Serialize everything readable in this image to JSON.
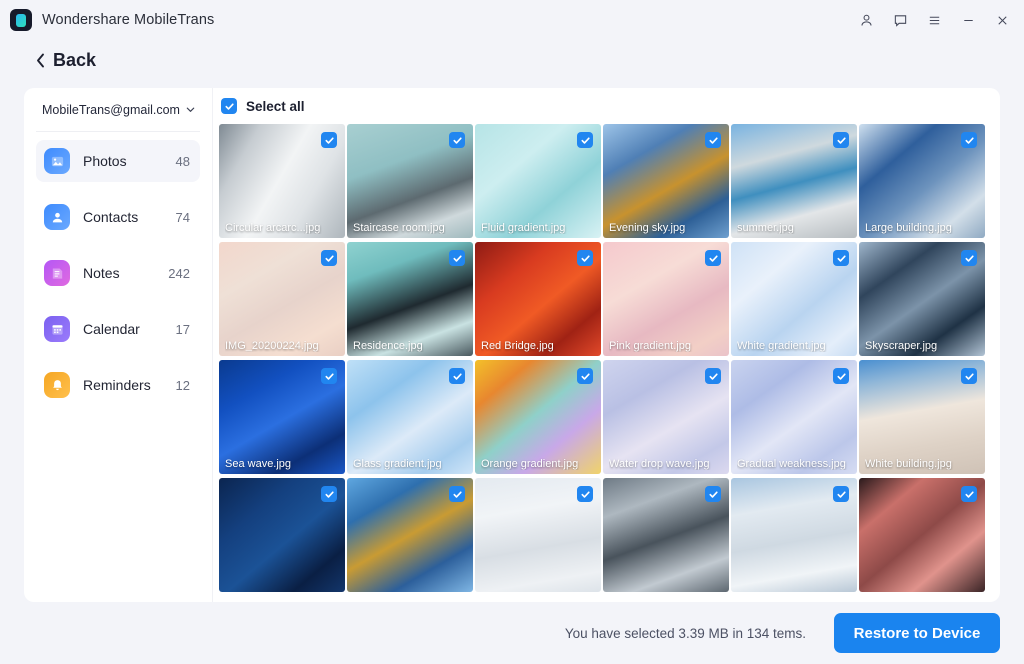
{
  "window": {
    "app_title": "Wondershare MobileTrans",
    "logo_icon": "mobiletrans-logo-icon",
    "controls": [
      {
        "name": "account-icon",
        "label": "Account"
      },
      {
        "name": "feedback-icon",
        "label": "Feedback"
      },
      {
        "name": "menu-icon",
        "label": "Menu"
      },
      {
        "name": "minimize-icon",
        "label": "Minimize"
      },
      {
        "name": "close-icon",
        "label": "Close"
      }
    ]
  },
  "nav": {
    "back_label": "Back",
    "back_icon": "chevron-left-icon"
  },
  "sidebar": {
    "account_email": "MobileTrans@gmail.com",
    "account_chevron_icon": "chevron-down-icon",
    "items": [
      {
        "label": "Photos",
        "count": "48",
        "icon": "photos-icon",
        "color1": "#3e8bfd",
        "color2": "#6ba9ff",
        "active": true
      },
      {
        "label": "Contacts",
        "count": "74",
        "icon": "contacts-icon",
        "color1": "#3e8bfd",
        "color2": "#6ba9ff",
        "active": false
      },
      {
        "label": "Notes",
        "count": "242",
        "icon": "notes-icon",
        "color1": "#b457f6",
        "color2": "#e06ae0",
        "active": false
      },
      {
        "label": "Calendar",
        "count": "17",
        "icon": "calendar-icon",
        "color1": "#7b61f0",
        "color2": "#9b7bfb",
        "active": false
      },
      {
        "label": "Reminders",
        "count": "12",
        "icon": "reminders-icon",
        "color1": "#f5a623",
        "color2": "#ffc04d",
        "active": false
      }
    ]
  },
  "main": {
    "select_all_label": "Select all",
    "select_all_checked": true,
    "check_icon": "checkmark-icon",
    "accent_color": "#2186f0",
    "photos": [
      {
        "name": "Circular arcarc...jpg",
        "checked": true,
        "bg": "linear-gradient(120deg,#7f8a93 0%,#c6ccd1 22%,#f2f4f5 48%,#dfe3e6 70%,#aeb6bc 100%)"
      },
      {
        "name": "Staircase room.jpg",
        "checked": true,
        "bg": "linear-gradient(160deg,#a8cfd1 0%,#8fbfc3 35%,#5d6a70 62%,#cfd9dc 82%,#9fb9bd 100%)"
      },
      {
        "name": "Fluid gradient.jpg",
        "checked": true,
        "bg": "linear-gradient(140deg,#b6e4e6 0%,#cdeef0 35%,#8fd2d8 65%,#d8f2f4 100%)"
      },
      {
        "name": "Evening sky.jpg",
        "checked": true,
        "bg": "linear-gradient(150deg,#9dc4e8 0%,#4f7fb5 28%,#c8922e 55%,#2d5f96 78%,#6fa0cf 100%)"
      },
      {
        "name": "summer.jpg",
        "checked": true,
        "bg": "linear-gradient(165deg,#79b3e0 0%,#cfd9de 30%,#3f8fbf 52%,#e3e6e8 75%,#b6bcc0 100%)"
      },
      {
        "name": "Large building.jpg",
        "checked": true,
        "bg": "linear-gradient(140deg,#cfe0ef 0%,#2f5f9c 30%,#6d93bd 55%,#d3dfe9 80%,#8fa9c2 100%)"
      },
      {
        "name": "IMG_20200224.jpg",
        "checked": true,
        "bg": "linear-gradient(150deg,#f2d7cc 0%,#efe0d6 30%,#e7d3cb 55%,#f5ded0 80%,#e9cfc4 100%)"
      },
      {
        "name": "Residence.jpg",
        "checked": true,
        "bg": "linear-gradient(160deg,#8fd2d0 0%,#6fbcbd 25%,#1f2a30 55%,#c9e2e2 78%,#49585e 100%)"
      },
      {
        "name": "Red Bridge.jpg",
        "checked": true,
        "bg": "linear-gradient(140deg,#8e1b14 0%,#d83b20 30%,#f05a25 55%,#a02214 78%,#e2492a 100%)"
      },
      {
        "name": "Pink gradient.jpg",
        "checked": true,
        "bg": "linear-gradient(150deg,#f5c9cd 0%,#f7dcd6 35%,#e7b9c2 62%,#f2cfc6 85%,#eac3c9 100%)"
      },
      {
        "name": "White gradient.jpg",
        "checked": true,
        "bg": "linear-gradient(140deg,#cfe2f6 0%,#e9f1fb 30%,#b9d4f0 60%,#e4eefa 85%,#c7dcf3 100%)"
      },
      {
        "name": "Skyscraper.jpg",
        "checked": true,
        "bg": "linear-gradient(145deg,#9fb6cc 0%,#30455c 28%,#7c93a9 52%,#1f3245 75%,#b2c4d5 100%)"
      },
      {
        "name": "Sea wave.jpg",
        "checked": true,
        "bg": "linear-gradient(150deg,#0a3a8f 0%,#1250c0 28%,#2b6fe0 52%,#0c2f77 78%,#1a57c6 100%)"
      },
      {
        "name": "Glass gradient.jpg",
        "checked": true,
        "bg": "linear-gradient(145deg,#bfe0f7 0%,#8dc3ec 30%,#dceaf8 58%,#a6cdee 82%,#cfe5f8 100%)"
      },
      {
        "name": "Orange gradient.jpg",
        "checked": true,
        "bg": "linear-gradient(140deg,#f3c02a 0%,#e8872f 22%,#8fd0c9 48%,#c8a8e8 70%,#f0d36a 100%)"
      },
      {
        "name": "Water drop wave.jpg",
        "checked": true,
        "bg": "linear-gradient(150deg,#cfd4ee 0%,#b9c0e4 30%,#e6e3f2 58%,#c3c8e8 82%,#dcd9ef 100%)"
      },
      {
        "name": "Gradual weakness.jpg",
        "checked": true,
        "bg": "linear-gradient(145deg,#c9d3ef 0%,#aebce6 28%,#e2e6f6 55%,#bcc7ea 80%,#d6dcf2 100%)"
      },
      {
        "name": "White building.jpg",
        "checked": true,
        "bg": "linear-gradient(170deg,#4a8fd0 0%,#8fb6d8 18%,#efe6dc 45%,#ded2c6 72%,#cfc2b6 100%)"
      },
      {
        "name": "",
        "checked": true,
        "bg": "linear-gradient(140deg,#0b2550 0%,#14407f 30%,#1b5296 55%,#0a1f44 80%,#13366b 100%)"
      },
      {
        "name": "",
        "checked": true,
        "bg": "linear-gradient(150deg,#5fa7e0 0%,#2e6fae 25%,#c99b33 50%,#2c5f9b 75%,#7fb6e4 100%)"
      },
      {
        "name": "",
        "checked": true,
        "bg": "linear-gradient(170deg,#e4eaf0 0%,#f1f4f7 30%,#d8dee4 60%,#eef1f4 85%,#dde3e9 100%)"
      },
      {
        "name": "",
        "checked": true,
        "bg": "linear-gradient(160deg,#6e7a85 0%,#aeb8c0 25%,#49535c 52%,#c2cad1 78%,#5d6770 100%)"
      },
      {
        "name": "",
        "checked": true,
        "bg": "linear-gradient(170deg,#a9c6e0 0%,#e2eaf1 28%,#cfd9e2 55%,#f0f4f7 80%,#b9c8d6 100%)"
      },
      {
        "name": "",
        "checked": true,
        "bg": "linear-gradient(140deg,#2a1a1c 0%,#c9706a 25%,#8e4a48 50%,#e0938c 72%,#3a2426 100%)"
      }
    ]
  },
  "footer": {
    "status_text": "You have selected 3.39 MB in 134 tems.",
    "restore_label": "Restore to Device",
    "restore_color": "#1a84ef"
  }
}
